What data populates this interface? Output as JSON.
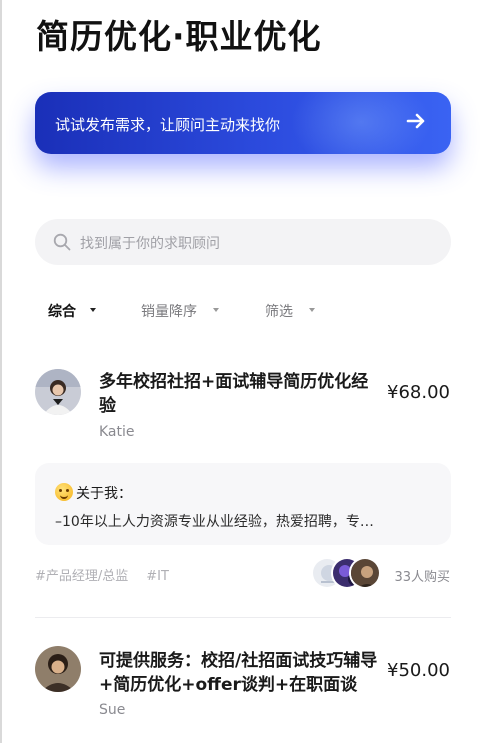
{
  "header": {
    "title": "简历优化·职业优化"
  },
  "banner": {
    "text": "试试发布需求，让顾问主动来找你",
    "icon": "arrow-right-icon"
  },
  "search": {
    "placeholder": "找到属于你的求职顾问",
    "icon": "search-icon"
  },
  "filters": [
    {
      "label": "综合",
      "active": true
    },
    {
      "label": "销量降序",
      "active": false
    },
    {
      "label": "筛选",
      "active": false
    }
  ],
  "listings": [
    {
      "title": "多年校招社招+面试辅导简历优化经验",
      "price": "¥68.00",
      "name": "Katie",
      "about_heading": "关于我：",
      "about_text": "–10年以上人力资源专业从业经验，热爱招聘，专…",
      "tags": [
        "#产品经理/总监",
        "#IT"
      ],
      "purchase_count": "33人购买"
    },
    {
      "title": "可提供服务：校招/社招面试技巧辅导+简历优化+offer谈判+在职面谈",
      "price": "¥50.00",
      "name": "Sue"
    }
  ],
  "colors": {
    "banner_start": "#1a2fb8",
    "banner_end": "#3a63f3",
    "search_bg": "#f3f3f5",
    "muted_text": "#8a8a90"
  }
}
